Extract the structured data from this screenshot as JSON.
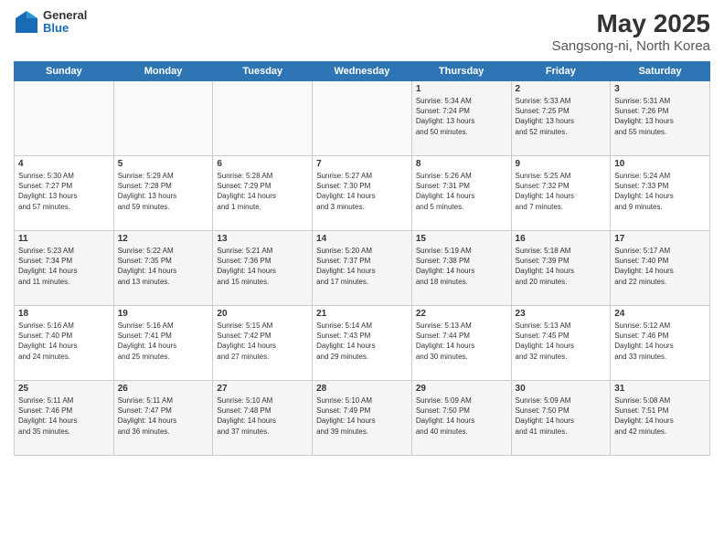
{
  "logo": {
    "general": "General",
    "blue": "Blue"
  },
  "title": {
    "month": "May 2025",
    "location": "Sangsong-ni, North Korea"
  },
  "weekdays": [
    "Sunday",
    "Monday",
    "Tuesday",
    "Wednesday",
    "Thursday",
    "Friday",
    "Saturday"
  ],
  "weeks": [
    [
      {
        "day": "",
        "info": ""
      },
      {
        "day": "",
        "info": ""
      },
      {
        "day": "",
        "info": ""
      },
      {
        "day": "",
        "info": ""
      },
      {
        "day": "1",
        "info": "Sunrise: 5:34 AM\nSunset: 7:24 PM\nDaylight: 13 hours\nand 50 minutes."
      },
      {
        "day": "2",
        "info": "Sunrise: 5:33 AM\nSunset: 7:25 PM\nDaylight: 13 hours\nand 52 minutes."
      },
      {
        "day": "3",
        "info": "Sunrise: 5:31 AM\nSunset: 7:26 PM\nDaylight: 13 hours\nand 55 minutes."
      }
    ],
    [
      {
        "day": "4",
        "info": "Sunrise: 5:30 AM\nSunset: 7:27 PM\nDaylight: 13 hours\nand 57 minutes."
      },
      {
        "day": "5",
        "info": "Sunrise: 5:29 AM\nSunset: 7:28 PM\nDaylight: 13 hours\nand 59 minutes."
      },
      {
        "day": "6",
        "info": "Sunrise: 5:28 AM\nSunset: 7:29 PM\nDaylight: 14 hours\nand 1 minute."
      },
      {
        "day": "7",
        "info": "Sunrise: 5:27 AM\nSunset: 7:30 PM\nDaylight: 14 hours\nand 3 minutes."
      },
      {
        "day": "8",
        "info": "Sunrise: 5:26 AM\nSunset: 7:31 PM\nDaylight: 14 hours\nand 5 minutes."
      },
      {
        "day": "9",
        "info": "Sunrise: 5:25 AM\nSunset: 7:32 PM\nDaylight: 14 hours\nand 7 minutes."
      },
      {
        "day": "10",
        "info": "Sunrise: 5:24 AM\nSunset: 7:33 PM\nDaylight: 14 hours\nand 9 minutes."
      }
    ],
    [
      {
        "day": "11",
        "info": "Sunrise: 5:23 AM\nSunset: 7:34 PM\nDaylight: 14 hours\nand 11 minutes."
      },
      {
        "day": "12",
        "info": "Sunrise: 5:22 AM\nSunset: 7:35 PM\nDaylight: 14 hours\nand 13 minutes."
      },
      {
        "day": "13",
        "info": "Sunrise: 5:21 AM\nSunset: 7:36 PM\nDaylight: 14 hours\nand 15 minutes."
      },
      {
        "day": "14",
        "info": "Sunrise: 5:20 AM\nSunset: 7:37 PM\nDaylight: 14 hours\nand 17 minutes."
      },
      {
        "day": "15",
        "info": "Sunrise: 5:19 AM\nSunset: 7:38 PM\nDaylight: 14 hours\nand 18 minutes."
      },
      {
        "day": "16",
        "info": "Sunrise: 5:18 AM\nSunset: 7:39 PM\nDaylight: 14 hours\nand 20 minutes."
      },
      {
        "day": "17",
        "info": "Sunrise: 5:17 AM\nSunset: 7:40 PM\nDaylight: 14 hours\nand 22 minutes."
      }
    ],
    [
      {
        "day": "18",
        "info": "Sunrise: 5:16 AM\nSunset: 7:40 PM\nDaylight: 14 hours\nand 24 minutes."
      },
      {
        "day": "19",
        "info": "Sunrise: 5:16 AM\nSunset: 7:41 PM\nDaylight: 14 hours\nand 25 minutes."
      },
      {
        "day": "20",
        "info": "Sunrise: 5:15 AM\nSunset: 7:42 PM\nDaylight: 14 hours\nand 27 minutes."
      },
      {
        "day": "21",
        "info": "Sunrise: 5:14 AM\nSunset: 7:43 PM\nDaylight: 14 hours\nand 29 minutes."
      },
      {
        "day": "22",
        "info": "Sunrise: 5:13 AM\nSunset: 7:44 PM\nDaylight: 14 hours\nand 30 minutes."
      },
      {
        "day": "23",
        "info": "Sunrise: 5:13 AM\nSunset: 7:45 PM\nDaylight: 14 hours\nand 32 minutes."
      },
      {
        "day": "24",
        "info": "Sunrise: 5:12 AM\nSunset: 7:46 PM\nDaylight: 14 hours\nand 33 minutes."
      }
    ],
    [
      {
        "day": "25",
        "info": "Sunrise: 5:11 AM\nSunset: 7:46 PM\nDaylight: 14 hours\nand 35 minutes."
      },
      {
        "day": "26",
        "info": "Sunrise: 5:11 AM\nSunset: 7:47 PM\nDaylight: 14 hours\nand 36 minutes."
      },
      {
        "day": "27",
        "info": "Sunrise: 5:10 AM\nSunset: 7:48 PM\nDaylight: 14 hours\nand 37 minutes."
      },
      {
        "day": "28",
        "info": "Sunrise: 5:10 AM\nSunset: 7:49 PM\nDaylight: 14 hours\nand 39 minutes."
      },
      {
        "day": "29",
        "info": "Sunrise: 5:09 AM\nSunset: 7:50 PM\nDaylight: 14 hours\nand 40 minutes."
      },
      {
        "day": "30",
        "info": "Sunrise: 5:09 AM\nSunset: 7:50 PM\nDaylight: 14 hours\nand 41 minutes."
      },
      {
        "day": "31",
        "info": "Sunrise: 5:08 AM\nSunset: 7:51 PM\nDaylight: 14 hours\nand 42 minutes."
      }
    ]
  ]
}
